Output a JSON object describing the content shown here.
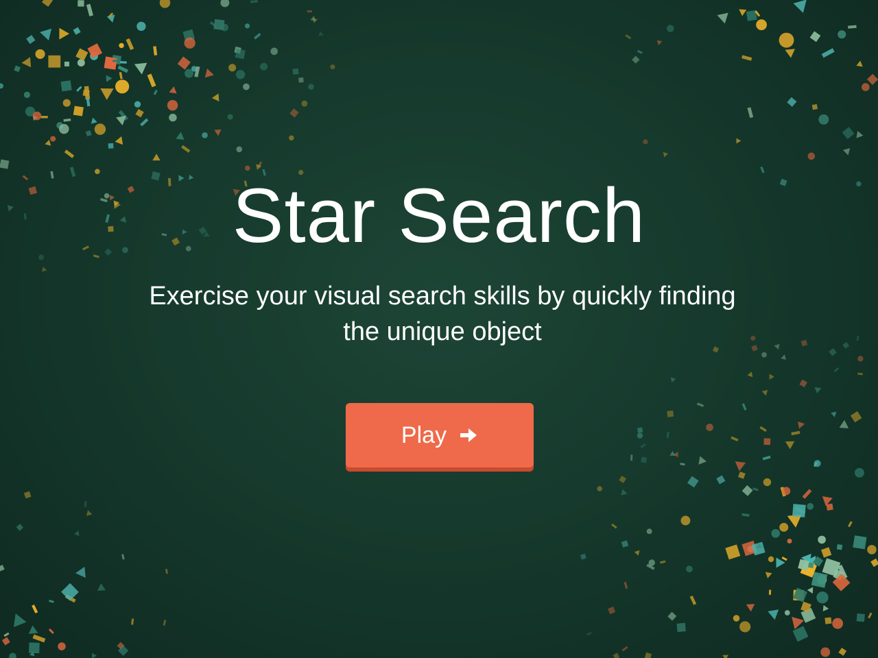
{
  "game": {
    "title": "Star Search",
    "subtitle": "Exercise your visual search skills by quickly finding the unique object",
    "play_label": "Play",
    "play_icon": "arrow-right-icon"
  },
  "colors": {
    "background": "#163a2d",
    "button": "#ee6a4a",
    "button_shadow": "#c94a2e",
    "text": "#ffffff",
    "confetti": [
      "#e0683e",
      "#c79a2a",
      "#4db3ad",
      "#8fc1a0",
      "#2f7a6a",
      "#3d8f7c",
      "#f0b429"
    ]
  }
}
